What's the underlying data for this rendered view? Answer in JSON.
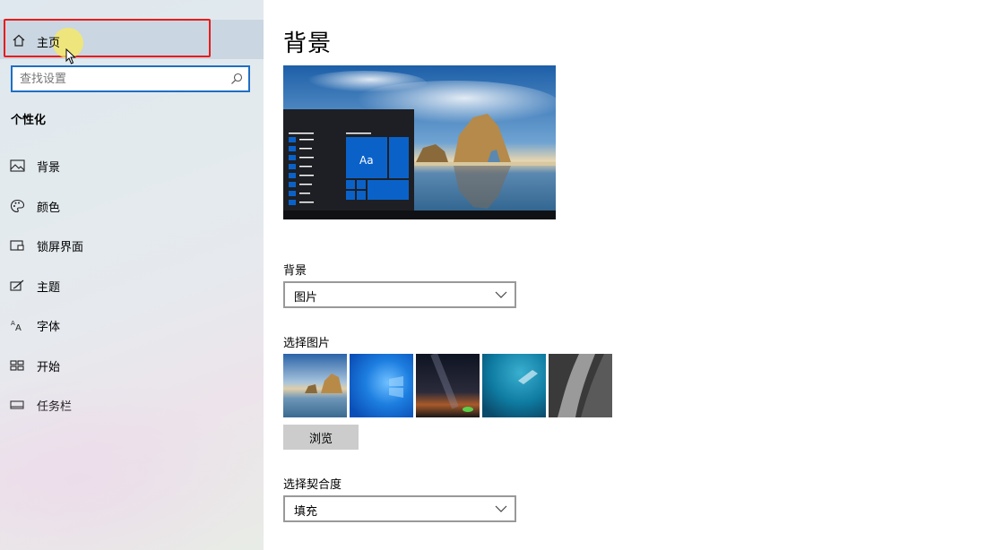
{
  "sidebar": {
    "home_label": "主页",
    "search_placeholder": "查找设置",
    "section_title": "个性化",
    "items": [
      {
        "label": "背景",
        "icon": "picture-icon"
      },
      {
        "label": "颜色",
        "icon": "palette-icon"
      },
      {
        "label": "锁屏界面",
        "icon": "lock-screen-icon"
      },
      {
        "label": "主题",
        "icon": "theme-icon"
      },
      {
        "label": "字体",
        "icon": "font-icon"
      },
      {
        "label": "开始",
        "icon": "start-icon"
      },
      {
        "label": "任务栏",
        "icon": "taskbar-icon"
      }
    ]
  },
  "main": {
    "title": "背景",
    "preview_tile_text": "Aa",
    "background_label": "背景",
    "background_value": "图片",
    "choose_picture_label": "选择图片",
    "browse_label": "浏览",
    "fit_label": "选择契合度",
    "fit_value": "填充"
  },
  "colors": {
    "accent": "#0078d7",
    "highlight_border": "#e81b1b",
    "search_border": "#1f6fc4"
  }
}
